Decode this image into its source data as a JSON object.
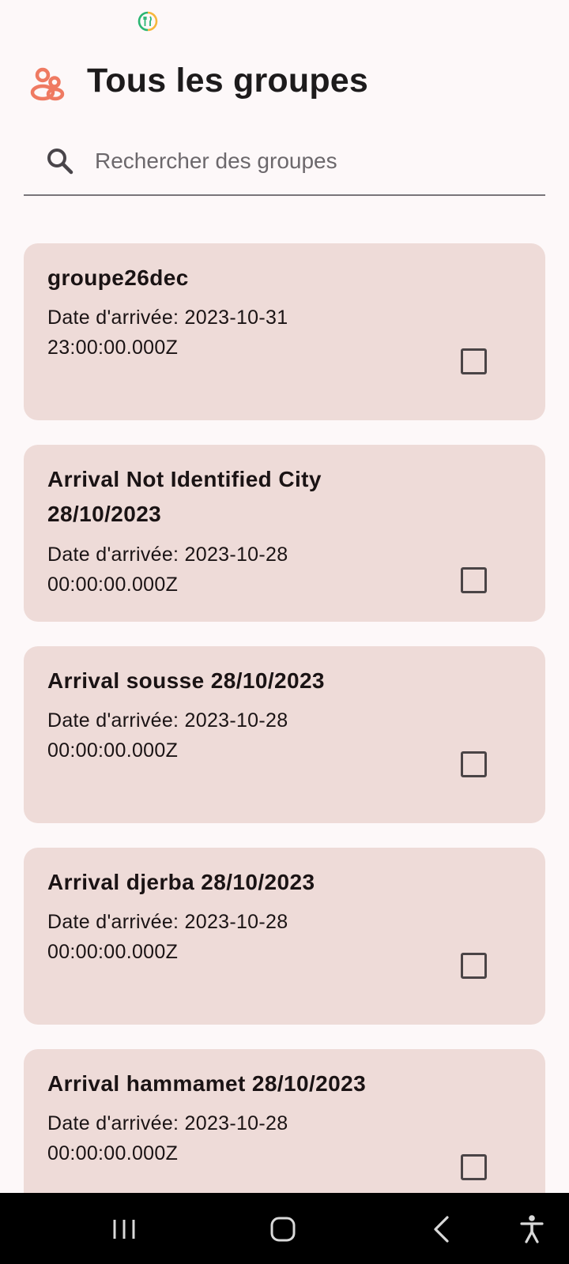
{
  "app": {
    "title": "Tous les groupes",
    "title_icon": "groups-icon",
    "accent_color": "#ef7a62"
  },
  "search": {
    "placeholder": "Rechercher des groupes",
    "value": "",
    "icon": "search-icon"
  },
  "groups": [
    {
      "name": "groupe26dec",
      "date_line1": "Date d'arrivée: 2023-10-31",
      "date_line2": "23:00:00.000Z",
      "checked": false
    },
    {
      "name": "Arrival Not Identified City 28/10/2023",
      "date_line1": "Date d'arrivée: 2023-10-28",
      "date_line2": "00:00:00.000Z",
      "checked": false
    },
    {
      "name": "Arrival sousse 28/10/2023",
      "date_line1": "Date d'arrivée: 2023-10-28",
      "date_line2": "00:00:00.000Z",
      "checked": false
    },
    {
      "name": "Arrival djerba 28/10/2023",
      "date_line1": "Date d'arrivée: 2023-10-28",
      "date_line2": "00:00:00.000Z",
      "checked": false
    },
    {
      "name": "Arrival hammamet 28/10/2023",
      "date_line1": "Date d'arrivée: 2023-10-28",
      "date_line2": "00:00:00.000Z",
      "checked": false
    }
  ],
  "colors": {
    "background": "#fdf8f9",
    "card": "#eedbd8",
    "nav_bar": "#000000"
  },
  "nav": {
    "icons": [
      "recent-apps-icon",
      "home-icon",
      "back-icon",
      "accessibility-icon"
    ]
  }
}
